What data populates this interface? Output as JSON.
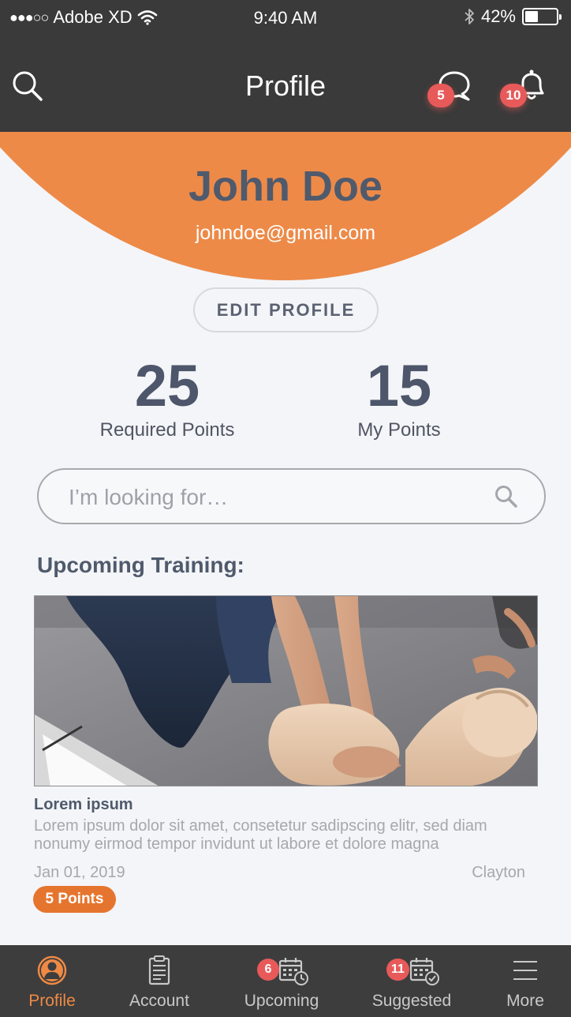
{
  "status_bar": {
    "signal": "●●●○○",
    "carrier": "Adobe XD",
    "time": "9:40 AM",
    "battery": "42%",
    "battery_level": 0.42
  },
  "nav": {
    "title": "Profile",
    "chat_badge": "5",
    "bell_badge": "10",
    "icons": [
      "search-icon",
      "chat-icon",
      "bell-icon"
    ]
  },
  "profile": {
    "name": "John Doe",
    "email": "johndoe@gmail.com",
    "edit_label": "EDIT PROFILE"
  },
  "stats": {
    "required": {
      "value": "25",
      "label": "Required Points"
    },
    "mine": {
      "value": "15",
      "label": "My Points"
    }
  },
  "search": {
    "placeholder": "I’m looking for…"
  },
  "section_title": "Upcoming Training:",
  "training": {
    "title": "Lorem ipsum",
    "description": "Lorem ipsum dolor sit amet, consetetur sadipscing elitr, sed diam nonumy eirmod tempor invidunt ut labore et dolore magna",
    "date": "Jan 01, 2019",
    "location": "Clayton",
    "points": "5 Points"
  },
  "tabs": [
    {
      "label": "Profile",
      "icon": "profile-icon",
      "active": true,
      "badge": ""
    },
    {
      "label": "Account",
      "icon": "clipboard-icon",
      "active": false,
      "badge": ""
    },
    {
      "label": "Upcoming",
      "icon": "calendar-clock-icon",
      "active": false,
      "badge": "6"
    },
    {
      "label": "Suggested",
      "icon": "calendar-check-icon",
      "active": false,
      "badge": "11"
    },
    {
      "label": "More",
      "icon": "menu-icon",
      "active": false,
      "badge": ""
    }
  ],
  "colors": {
    "accent": "#ed8a48",
    "dark_bar": "#3a3a3a",
    "badge_red": "#e85a5a",
    "text_slate": "#4f5a6c"
  }
}
